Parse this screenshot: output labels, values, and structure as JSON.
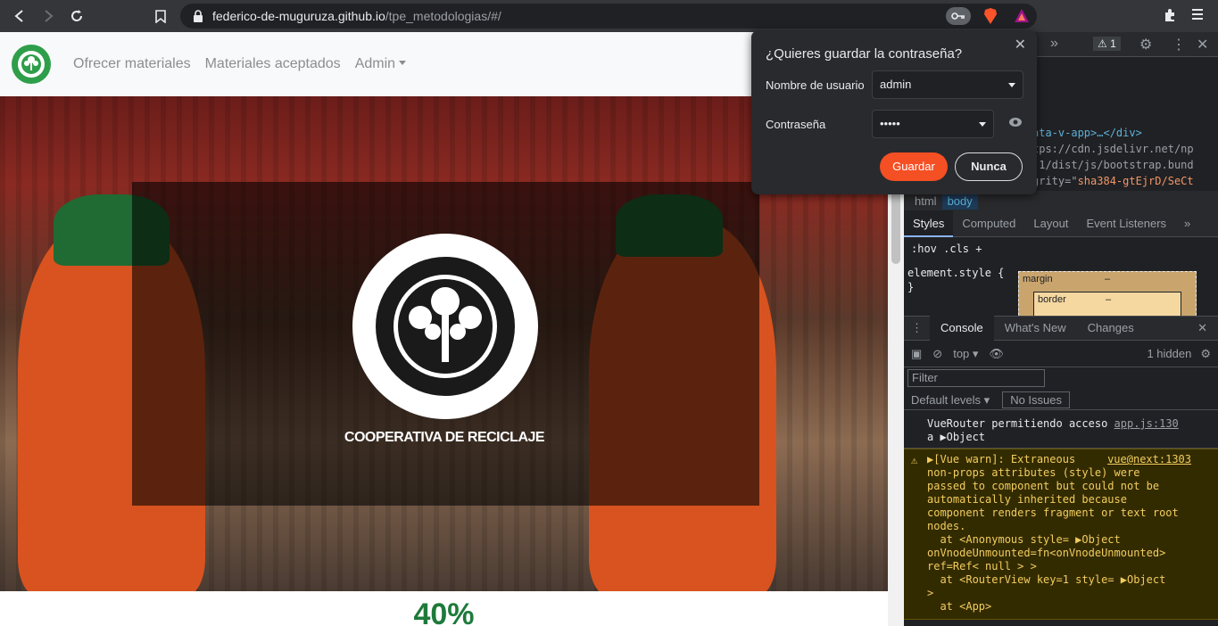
{
  "browser": {
    "url_host": "federico-de-muguruza.github.io",
    "url_path": "/tpe_metodologias/#/"
  },
  "page": {
    "nav": {
      "items": [
        "Ofrecer materiales",
        "Materiales aceptados",
        "Admin"
      ]
    },
    "hero_title": "COOPERATIVA DE RECICLAJE",
    "stat": "40%"
  },
  "password_prompt": {
    "title": "¿Quieres guardar la contraseña?",
    "username_label": "Nombre de usuario",
    "username_value": "admin",
    "password_label": "Contraseña",
    "password_value": "•••••",
    "save_label": "Guardar",
    "never_label": "Nunca"
  },
  "devtools": {
    "issues_count": "1",
    "elements_lines": [
      "ata-v-app>…</div>",
      "tps://cdn.jsdelivr.net/np",
      ".1/dist/js/bootstrap.bund",
      "grity=\"",
      "sha384-gtEjrD/SeCt"
    ],
    "breadcrumbs": [
      "html",
      "body"
    ],
    "style_tabs": [
      "Styles",
      "Computed",
      "Layout",
      "Event Listeners"
    ],
    "filter_hint": ":hov  .cls  +",
    "element_style": "element.style {\n}",
    "box_margin": "margin",
    "box_border": "border",
    "dash": "–",
    "console_tabs": [
      "Console",
      "What's New",
      "Changes"
    ],
    "context": "top",
    "hidden_count": "1 hidden",
    "filter_placeholder": "Filter",
    "default_levels": "Default levels",
    "no_issues": "No Issues",
    "log1_text": "VueRouter permitiendo acceso",
    "log1_src": "app.js:130",
    "log1_obj": "a ▶Object",
    "warn_src": "vue@next:1303",
    "warn_text": "▶[Vue warn]: Extraneous\nnon-props attributes (style) were\npassed to component but could not be\nautomatically inherited because\ncomponent renders fragment or text root\nnodes.\n  at <Anonymous style= ▶Object\nonVnodeUnmounted=fn<onVnodeUnmounted>\nref=Ref< null > >\n  at <RouterView key=1 style= ▶Object\n>\n  at <App>"
  },
  "colors": {
    "accent": "#f54f24",
    "brand_green": "#1e7a3a",
    "warn_yellow": "#f2cd60"
  }
}
